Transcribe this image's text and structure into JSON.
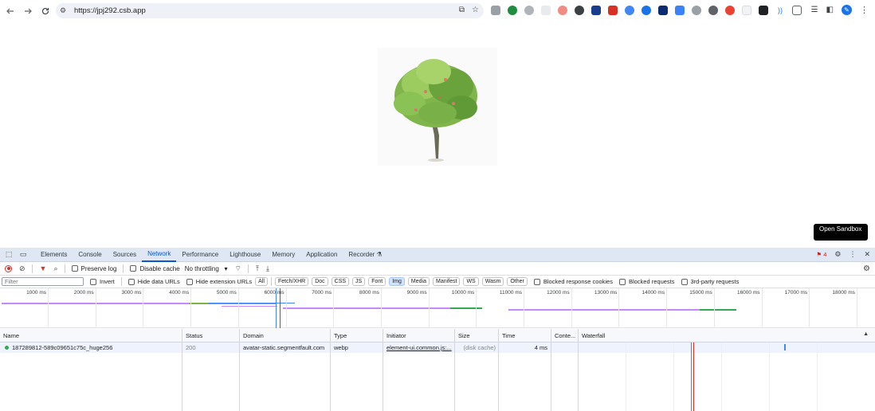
{
  "browser": {
    "url": "https://jpj292.csb.app",
    "nav": {
      "back_icon": "arrow-left-icon",
      "forward_icon": "arrow-right-icon",
      "reload_icon": "reload-icon"
    }
  },
  "page": {
    "sandbox_label": "Open Sandbox"
  },
  "devtools": {
    "tabs": [
      "Elements",
      "Console",
      "Sources",
      "Network",
      "Performance",
      "Lighthouse",
      "Memory",
      "Application",
      "Recorder"
    ],
    "active_tab": "Network",
    "issues_count": "4",
    "toolbar": {
      "preserve_log": "Preserve log",
      "disable_cache": "Disable cache",
      "throttling": "No throttling"
    },
    "filter": {
      "placeholder": "Filter",
      "invert": "Invert",
      "hide_data_urls": "Hide data URLs",
      "hide_extension_urls": "Hide extension URLs",
      "types": [
        "All",
        "Fetch/XHR",
        "Doc",
        "CSS",
        "JS",
        "Font",
        "Img",
        "Media",
        "Manifest",
        "WS",
        "Wasm",
        "Other"
      ],
      "active_type": "Img",
      "blocked_cookies": "Blocked response cookies",
      "blocked_requests": "Blocked requests",
      "third_party": "3rd-party requests"
    },
    "overview_ticks": [
      "1000 ms",
      "2000 ms",
      "3000 ms",
      "4000 ms",
      "5000 ms",
      "6000 ms",
      "7000 ms",
      "8000 ms",
      "9000 ms",
      "10000 ms",
      "11000 ms",
      "12000 ms",
      "13000 ms",
      "14000 ms",
      "15000 ms",
      "16000 ms",
      "17000 ms",
      "18000 ms"
    ],
    "columns": [
      "Name",
      "Status",
      "Domain",
      "Type",
      "Initiator",
      "Size",
      "Time",
      "Conte...",
      "Waterfall"
    ],
    "rows": [
      {
        "name": "187289812-589c09651c75c_huge256",
        "status": "200",
        "domain": "avatar-static.segmentfault.com",
        "type": "webp",
        "initiator": "element-ui.common.js:...",
        "size": "(disk cache)",
        "time": "4 ms",
        "content": ""
      }
    ]
  }
}
